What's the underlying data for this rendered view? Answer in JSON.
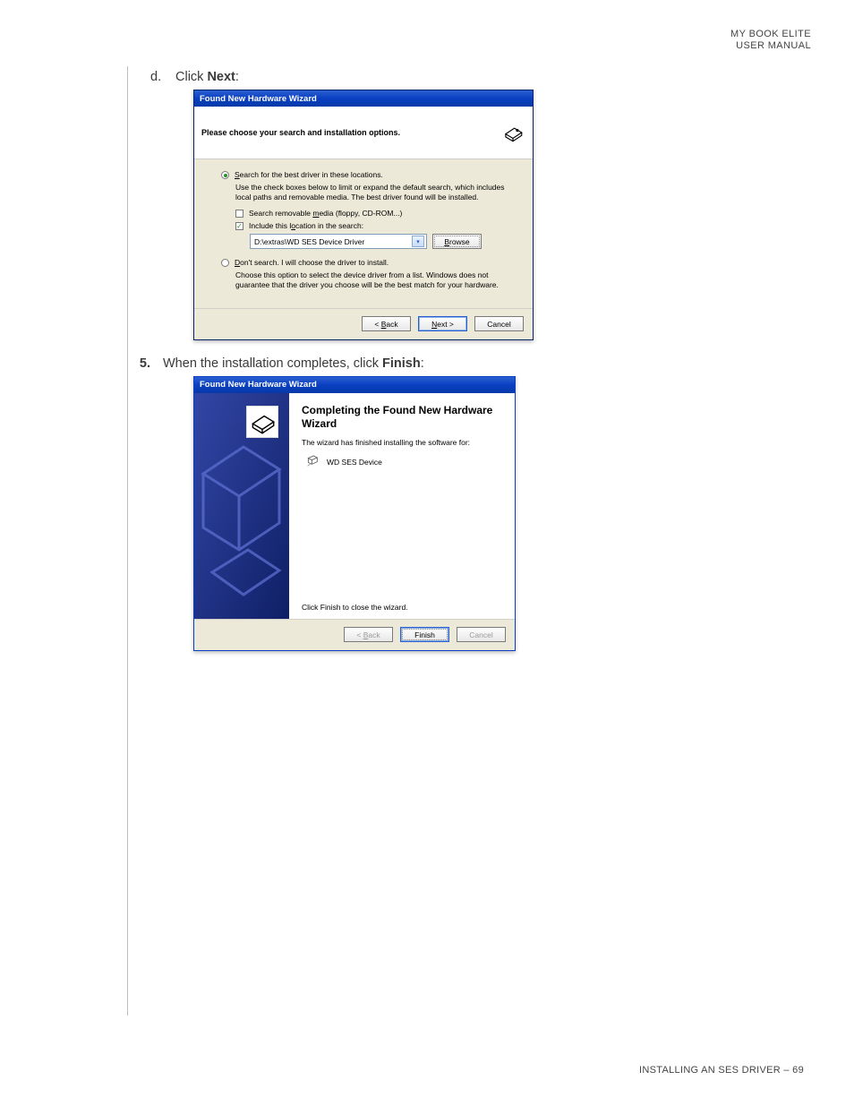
{
  "header": {
    "line1": "MY BOOK ELITE",
    "line2": "USER MANUAL"
  },
  "steps": {
    "d": {
      "marker": "d.",
      "pre": "Click ",
      "bold": "Next",
      "post": ":"
    },
    "s5": {
      "marker": "5.",
      "pre": "When the installation completes, click ",
      "bold": "Finish",
      "post": ":"
    }
  },
  "dlg1": {
    "title": "Found New Hardware Wizard",
    "topline": "Please choose your search and installation options.",
    "radio1_pre": "S",
    "radio1_rest": "earch for the best driver in these locations.",
    "help1": "Use the check boxes below to limit or expand the default search, which includes local paths and removable media. The best driver found will be installed.",
    "check1_pre": "Search removable ",
    "check1_u": "m",
    "check1_rest": "edia (floppy, CD-ROM...)",
    "check2_pre": "Include this l",
    "check2_u": "o",
    "check2_rest": "cation in the search:",
    "path": "D:\\extras\\WD SES Device Driver",
    "browse_u": "B",
    "browse_rest": "rowse",
    "radio2_u": "D",
    "radio2_rest": "on't search. I will choose the driver to install.",
    "help2": "Choose this option to select the device driver from a list. Windows does not guarantee that the driver you choose will be the best match for your hardware.",
    "back_pre": "< ",
    "back_u": "B",
    "back_rest": "ack",
    "next_u": "N",
    "next_rest": "ext >",
    "cancel": "Cancel"
  },
  "dlg2": {
    "title": "Found New Hardware Wizard",
    "heading": "Completing the Found New Hardware Wizard",
    "line": "The wizard has finished installing the software for:",
    "device": "WD SES Device",
    "bottom": "Click Finish to close the wizard.",
    "back_pre": "< ",
    "back_u": "B",
    "back_rest": "ack",
    "finish": "Finish",
    "cancel": "Cancel"
  },
  "footer": {
    "text": "INSTALLING AN SES DRIVER – 69"
  }
}
